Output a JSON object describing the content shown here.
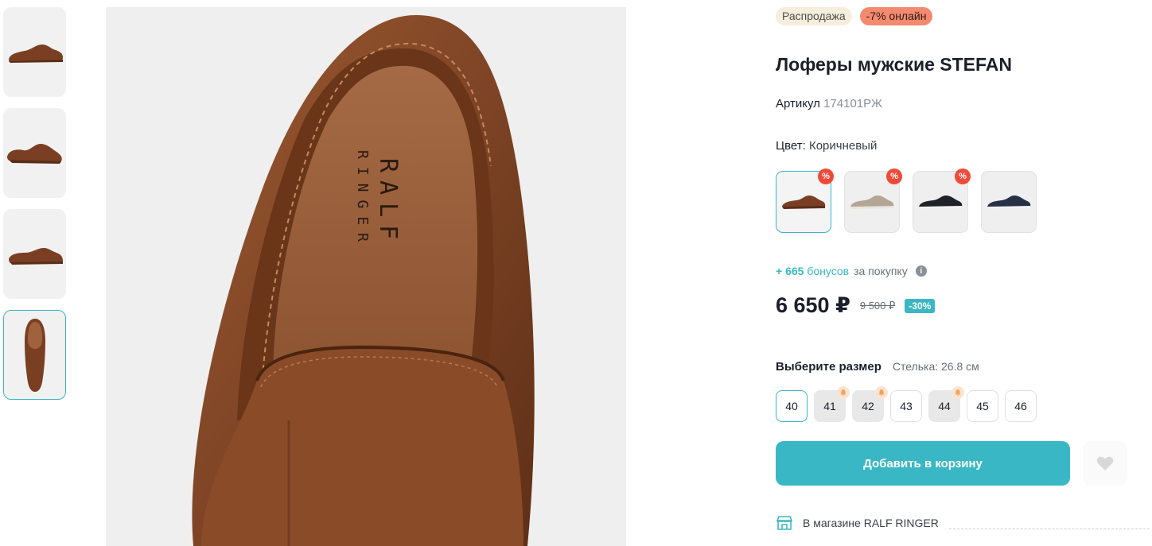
{
  "badges": {
    "sale": "Распродажа",
    "online": "-7% онлайн"
  },
  "product": {
    "title": "Лоферы мужские STEFAN",
    "sku_label": "Артикул",
    "sku_value": "174101РЖ",
    "color_label": "Цвет:",
    "color_value": "Коричневый"
  },
  "swatches": [
    {
      "name": "brown",
      "color": "#7a3f22",
      "discount": "%"
    },
    {
      "name": "beige",
      "color": "#b3a696",
      "discount": "%"
    },
    {
      "name": "black",
      "color": "#1f2329",
      "discount": "%"
    },
    {
      "name": "navy",
      "color": "#263047",
      "discount": ""
    }
  ],
  "bonus": {
    "amount": "+ 665",
    "word": "бонусов",
    "rest": "за покупку",
    "info": "i"
  },
  "price": {
    "current": "6 650 ₽",
    "old": "9 500 ₽",
    "discount": "-30%"
  },
  "size": {
    "label": "Выберите размер",
    "insole": "Стелька: 26.8 см",
    "options": [
      "40",
      "41",
      "42",
      "43",
      "44",
      "45",
      "46"
    ]
  },
  "cart": {
    "label": "Добавить в корзину"
  },
  "store": {
    "label": "В магазине RALF RINGER"
  },
  "main_image": {
    "brand_line1": "RALF",
    "brand_line2": "RINGER"
  },
  "colors": {
    "accent": "#3ab7c4",
    "sale_badge": "#f6eedc",
    "online_badge": "#f38a6f",
    "percent_badge": "#ef4a3a"
  }
}
